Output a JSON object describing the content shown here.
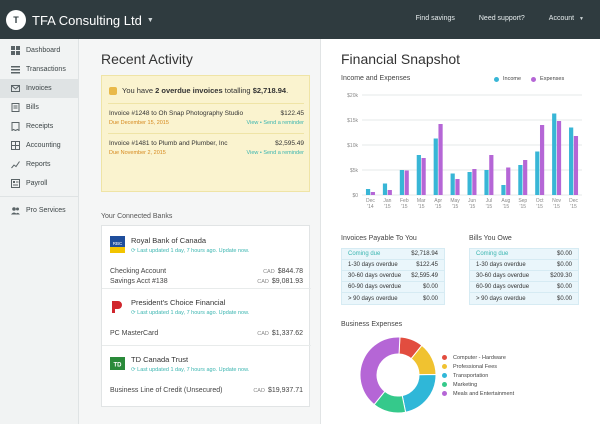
{
  "app": {
    "brand_initial": "T",
    "brand_name": "TFA Consulting Ltd",
    "nav": [
      {
        "label": "Find savings"
      },
      {
        "label": "Need support?"
      },
      {
        "label": "Account"
      }
    ]
  },
  "sidebar": {
    "items": [
      {
        "label": "Dashboard",
        "icon": "dashboard-icon"
      },
      {
        "label": "Transactions",
        "icon": "transactions-icon"
      },
      {
        "label": "Invoices",
        "icon": "invoices-icon",
        "active": true
      },
      {
        "label": "Bills",
        "icon": "bills-icon"
      },
      {
        "label": "Receipts",
        "icon": "receipts-icon"
      },
      {
        "label": "Accounting",
        "icon": "accounting-icon"
      },
      {
        "label": "Reports",
        "icon": "reports-icon"
      },
      {
        "label": "Payroll",
        "icon": "payroll-icon"
      }
    ],
    "pro": {
      "label": "Pro Services",
      "icon": "pro-services-icon"
    }
  },
  "recent": {
    "title": "Recent Activity",
    "alert_prefix": "You have ",
    "alert_bold": "2 overdue invoices",
    "alert_mid": " totalling ",
    "alert_amount": "$2,718.94",
    "alert_suffix": ".",
    "invoices": [
      {
        "title": "Invoice #1248 to Oh Snap Photography Studio",
        "amount": "$122.45",
        "due": "Due December 15, 2015",
        "actions": "View • Send a reminder"
      },
      {
        "title": "Invoice #1481 to Plumb and Plumber, Inc",
        "amount": "$2,595.49",
        "due": "Due November 2, 2015",
        "actions": "View • Send a reminder"
      }
    ]
  },
  "banks": {
    "title": "Your Connected Banks",
    "list": [
      {
        "name": "Royal Bank of Canada",
        "updated": "Last updated 1 day, 7 hours ago. Update now.",
        "logo_color": "#1f4e9c",
        "logo_text": "RBC",
        "accounts": [
          {
            "name": "Checking Account",
            "currency": "CAD",
            "amount": "$844.78"
          },
          {
            "name": "Savings Acct #138",
            "currency": "CAD",
            "amount": "$9,081.93"
          }
        ]
      },
      {
        "name": "President's Choice Financial",
        "updated": "Last updated 1 day, 7 hours ago. Update now.",
        "logo_color": "#d0262d",
        "logo_text": "PC",
        "accounts": [
          {
            "name": "PC MasterCard",
            "currency": "CAD",
            "amount": "$1,337.62"
          }
        ]
      },
      {
        "name": "TD Canada Trust",
        "updated": "Last updated 1 day, 7 hours ago. Update now.",
        "logo_color": "#2a8a3a",
        "logo_text": "TD",
        "accounts": [
          {
            "name": "Business Line of Credit (Unsecured)",
            "currency": "CAD",
            "amount": "$19,937.71"
          }
        ]
      }
    ]
  },
  "snapshot": {
    "title": "Financial Snapshot",
    "chart_title": "Income and Expenses",
    "legend": [
      {
        "name": "Income",
        "color": "#38b6d6"
      },
      {
        "name": "Expenses",
        "color": "#b566d6"
      }
    ]
  },
  "chart_data": {
    "type": "bar",
    "title": "Income and Expenses",
    "categories": [
      "Dec '14",
      "Jan '15",
      "Feb '15",
      "Mar '15",
      "Apr '15",
      "May '15",
      "Jun '15",
      "Jul '15",
      "Aug '15",
      "Sep '15",
      "Oct '15",
      "Nov '15",
      "Dec '15"
    ],
    "tick_labels": [
      [
        "Dec",
        "14"
      ],
      [
        "Jan",
        "15"
      ],
      [
        "Feb",
        "15"
      ],
      [
        "Mar",
        "15"
      ],
      [
        "Apr",
        "15"
      ],
      [
        "May",
        "15"
      ],
      [
        "Jun",
        "15"
      ],
      [
        "Jul",
        "15"
      ],
      [
        "Aug",
        "15"
      ],
      [
        "Sep",
        "15"
      ],
      [
        "Oct",
        "15"
      ],
      [
        "Nov",
        "15"
      ],
      [
        "Dec",
        "15"
      ]
    ],
    "series": [
      {
        "name": "Income",
        "color": "#38b6d6",
        "values": [
          1.2,
          2.3,
          5.0,
          8.0,
          11.3,
          4.3,
          4.6,
          5.0,
          2.0,
          6.0,
          8.7,
          16.3,
          13.5
        ]
      },
      {
        "name": "Expenses",
        "color": "#b566d6",
        "values": [
          0.6,
          1.0,
          4.9,
          7.4,
          14.2,
          3.2,
          5.2,
          8.0,
          5.5,
          7.0,
          14.0,
          14.8,
          11.8
        ]
      }
    ],
    "y_ticks": [
      "$0",
      "$5k",
      "$10k",
      "$15k",
      "$20k"
    ],
    "ylim": [
      0,
      20
    ],
    "grid": true,
    "legend": "top-right"
  },
  "payable": {
    "title": "Invoices Payable To You",
    "rows": [
      {
        "k": "Coming due",
        "v": "$2,718.94",
        "teal": true
      },
      {
        "k": "1-30 days overdue",
        "v": "$122.45"
      },
      {
        "k": "30-60 days overdue",
        "v": "$2,595.49"
      },
      {
        "k": "60-90 days overdue",
        "v": "$0.00"
      },
      {
        "k": "> 90 days overdue",
        "v": "$0.00"
      }
    ]
  },
  "bills": {
    "title": "Bills You Owe",
    "rows": [
      {
        "k": "Coming due",
        "v": "$0.00",
        "teal": true
      },
      {
        "k": "1-30 days overdue",
        "v": "$0.00"
      },
      {
        "k": "30-60 days overdue",
        "v": "$209.30"
      },
      {
        "k": "60-90 days overdue",
        "v": "$0.00"
      },
      {
        "k": "> 90 days overdue",
        "v": "$0.00"
      }
    ]
  },
  "expenses": {
    "title": "Business Expenses",
    "slices": [
      {
        "name": "Computer - Hardware",
        "color": "#e24d3f",
        "value": 10
      },
      {
        "name": "Professional Fees",
        "color": "#f0c230",
        "value": 14
      },
      {
        "name": "Transportation",
        "color": "#2fb7d8",
        "value": 22
      },
      {
        "name": "Marketing",
        "color": "#35c98b",
        "value": 14
      },
      {
        "name": "Meals and Entertainment",
        "color": "#b566d6",
        "value": 40
      }
    ]
  }
}
